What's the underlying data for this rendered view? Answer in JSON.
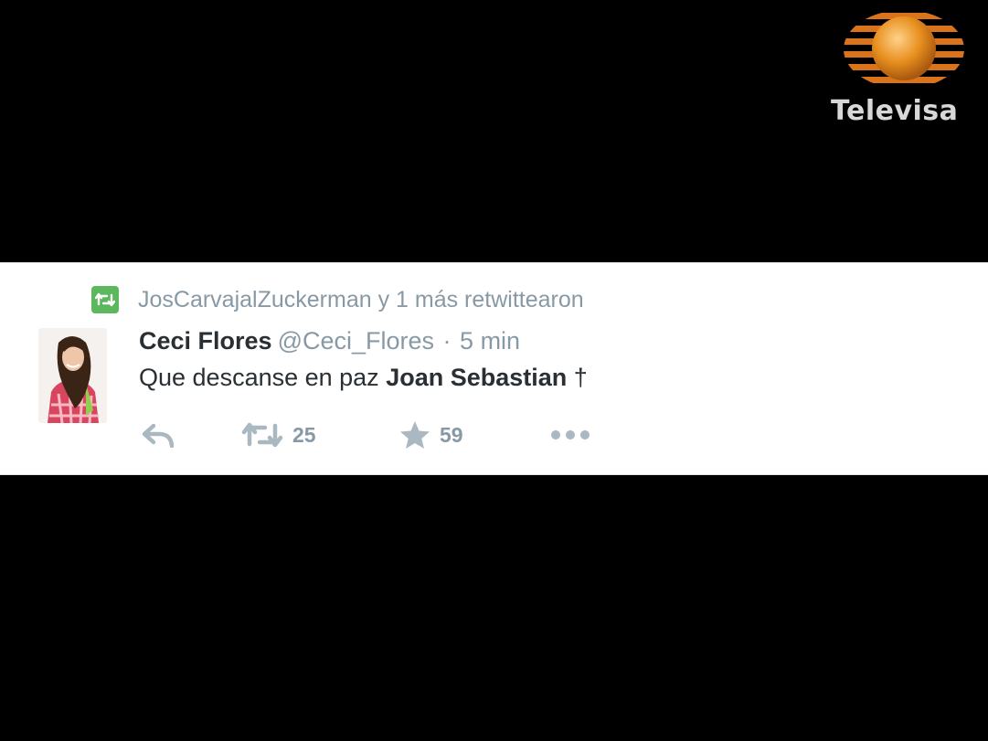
{
  "logo": {
    "text": "Televisa"
  },
  "tweet": {
    "retweet_context": "JosCarvajalZuckerman y 1 más retwittearon",
    "author_name": "Ceci Flores",
    "handle": "@Ceci_Flores",
    "separator": "·",
    "time": "5 min",
    "body_prefix": "Que descanse en paz ",
    "body_bold": "Joan Sebastian",
    "body_suffix": " †",
    "actions": {
      "reply_icon": "reply-icon",
      "retweet_icon": "retweet-icon",
      "retweet_count": "25",
      "favorite_icon": "star-icon",
      "favorite_count": "59",
      "more_icon": "more-icon"
    }
  },
  "colors": {
    "background": "#000000",
    "card": "#ffffff",
    "retweet_badge": "#5cb85c",
    "muted_text": "#8899a6",
    "primary_text": "#292f33",
    "icon": "#aab8c2",
    "logo_orange": "#e07a1f"
  }
}
